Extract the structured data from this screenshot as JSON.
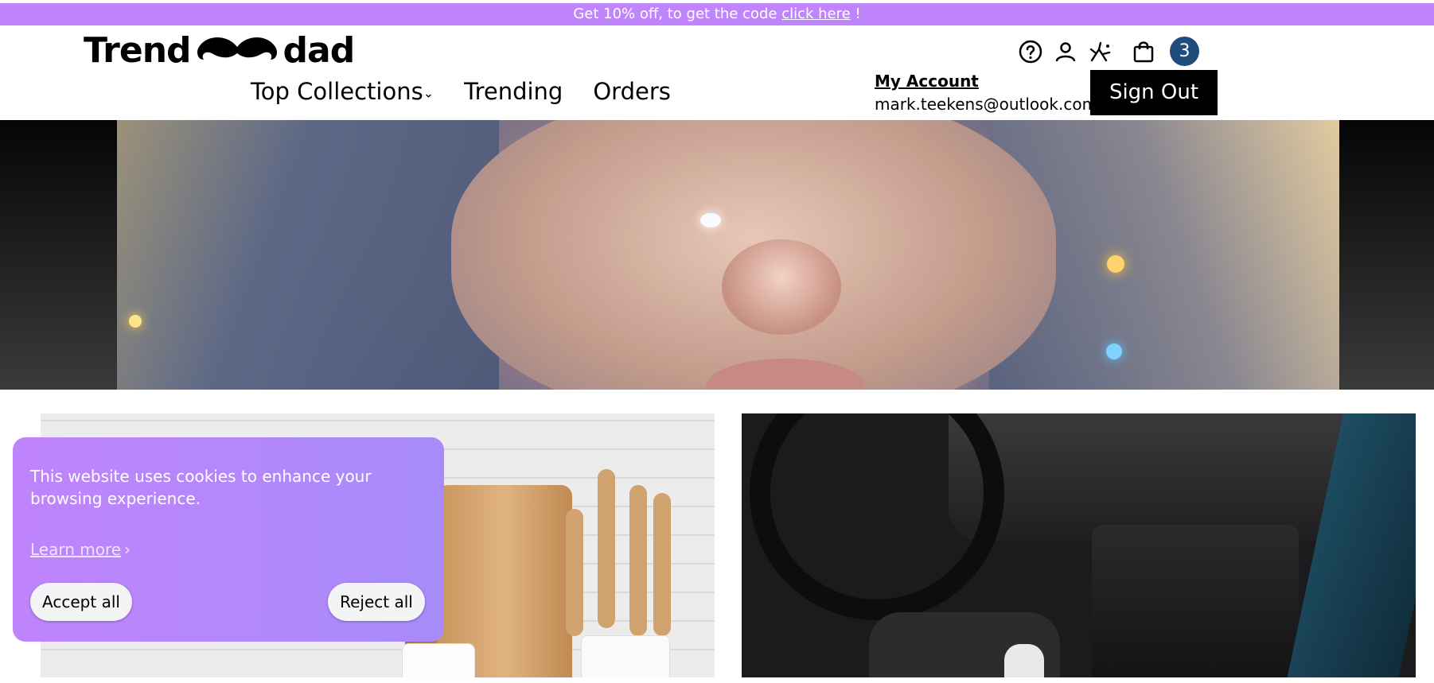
{
  "promo": {
    "text_before": "Get 10% off, to get the code ",
    "link": "click here",
    "text_after": " !"
  },
  "header": {
    "logo_left": "Trend",
    "logo_right": "dad",
    "nav": [
      {
        "label": "Top Collections",
        "has_dropdown": true
      },
      {
        "label": "Trending"
      },
      {
        "label": "Orders"
      }
    ],
    "icons": [
      "help-icon",
      "user-icon",
      "sparkle-icon",
      "shopping-bag-icon"
    ],
    "cart_count": "3",
    "account": {
      "link": "My Account",
      "email": "mark.teekens@outlook.com"
    },
    "sign_out": "Sign Out"
  },
  "cookie_banner": {
    "message": "This website uses cookies to enhance your browsing experience.",
    "learn_more": "Learn more",
    "learn_more_chevron": "›",
    "accept": "Accept all",
    "reject": "Reject all"
  },
  "colors": {
    "promo_bg": "#c084fc",
    "cookie_bg": "#b084f9",
    "badge": "#1e4d7b",
    "signout_bg": "#000000"
  }
}
